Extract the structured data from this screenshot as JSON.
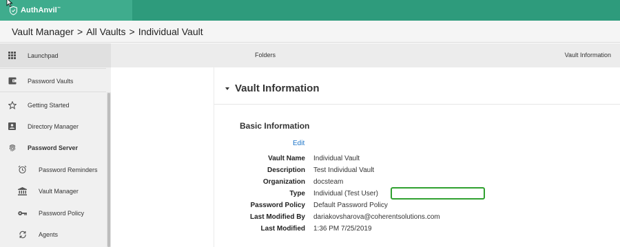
{
  "header": {
    "logo_text": "AuthAnvil",
    "logo_tm": "™",
    "brand_color": "#2e9b7c"
  },
  "breadcrumb": {
    "items": [
      "Vault Manager",
      "All Vaults",
      "Individual Vault"
    ],
    "separator": ">"
  },
  "sidebar": {
    "items": [
      {
        "label": "Launchpad",
        "icon": "grid-icon"
      },
      {
        "label": "Password Vaults",
        "icon": "wallet-icon"
      },
      {
        "label": "Getting Started",
        "icon": "star-icon"
      },
      {
        "label": "Directory Manager",
        "icon": "contact-card-icon"
      },
      {
        "label": "Password Server",
        "icon": "fingerprint-icon"
      },
      {
        "label": "Password Reminders",
        "icon": "alarm-clock-icon"
      },
      {
        "label": "Vault Manager",
        "icon": "bank-icon"
      },
      {
        "label": "Password Policy",
        "icon": "key-icon"
      },
      {
        "label": "Agents",
        "icon": "sync-icon"
      }
    ]
  },
  "tabs": {
    "folders": "Folders",
    "vault_information": "Vault Information"
  },
  "vault": {
    "panel_title": "Vault Information",
    "section_title": "Basic Information",
    "edit_label": "Edit",
    "fields": [
      {
        "key": "Vault Name",
        "value": "Individual Vault"
      },
      {
        "key": "Description",
        "value": "Test Individual Vault"
      },
      {
        "key": "Organization",
        "value": "docsteam"
      },
      {
        "key": "Type",
        "value": "Individual (Test User)"
      },
      {
        "key": "Password Policy",
        "value": "Default Password Policy"
      },
      {
        "key": "Last Modified By",
        "value": "dariakovsharova@coherentsolutions.com"
      },
      {
        "key": "Last Modified",
        "value": "1:36 PM 7/25/2019"
      }
    ],
    "highlight_color": "#2ea02e"
  }
}
